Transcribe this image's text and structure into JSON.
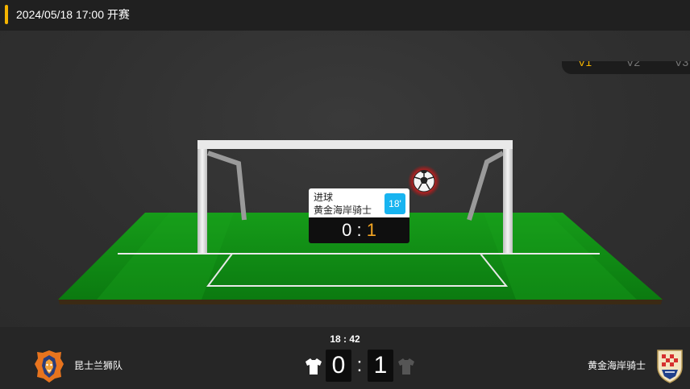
{
  "header": {
    "match_time": "2024/05/18 17:00 开赛",
    "accent_color": "#f5b400"
  },
  "view_tabs": [
    "V1",
    "V2",
    "V3"
  ],
  "active_view": "V1",
  "event": {
    "type": "进球",
    "team": "黄金海岸骑士",
    "minute": "18'",
    "score_home": "0",
    "score_sep": ":",
    "score_away": "1"
  },
  "scoreboard": {
    "clock": "18 : 42",
    "home_team": "昆士兰狮队",
    "away_team": "黄金海岸骑士",
    "home_score": "0",
    "away_score": "1",
    "separator": ":",
    "home_shirt_color": "#ffffff",
    "away_shirt_color": "#555555"
  },
  "icons": {
    "ball": "soccer-ball-icon",
    "home_logo": "lion-crest-icon",
    "away_logo": "checkered-shield-icon"
  }
}
